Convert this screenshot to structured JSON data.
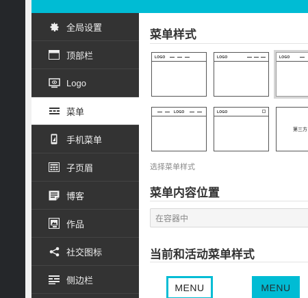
{
  "sidebar": {
    "items": [
      {
        "label": "全局设置",
        "icon": "gear-icon"
      },
      {
        "label": "顶部栏",
        "icon": "top-bar-icon"
      },
      {
        "label": "Logo",
        "icon": "logo-monitor-icon"
      },
      {
        "label": "菜单",
        "icon": "menu-icon"
      },
      {
        "label": "手机菜单",
        "icon": "mobile-icon"
      },
      {
        "label": "子页眉",
        "icon": "subheader-icon"
      },
      {
        "label": "博客",
        "icon": "blog-icon"
      },
      {
        "label": "作品",
        "icon": "portfolio-icon"
      },
      {
        "label": "社交图标",
        "icon": "share-icon"
      },
      {
        "label": "侧边栏",
        "icon": "sidebar-icon"
      }
    ],
    "active_index": 3
  },
  "main": {
    "menu_style_title": "菜单样式",
    "menu_styles": [
      {
        "logo": "LOGO"
      },
      {
        "logo": "LOGO"
      },
      {
        "logo": "LOGO"
      },
      {
        "logo": "LOGO"
      },
      {
        "logo": "LOGO"
      },
      {
        "label": "第三方"
      }
    ],
    "menu_style_hint": "选择菜单样式",
    "menu_content_position_title": "菜单内容位置",
    "menu_content_position_value": "在容器中",
    "active_menu_style_title": "当前和活动菜单样式",
    "menu_button_outline": "MENU",
    "menu_button_filled": "MENU"
  },
  "colors": {
    "accent": "#00bcd4",
    "sidebar_bg": "#333333",
    "sidebar_active_bg": "#ffffff"
  }
}
